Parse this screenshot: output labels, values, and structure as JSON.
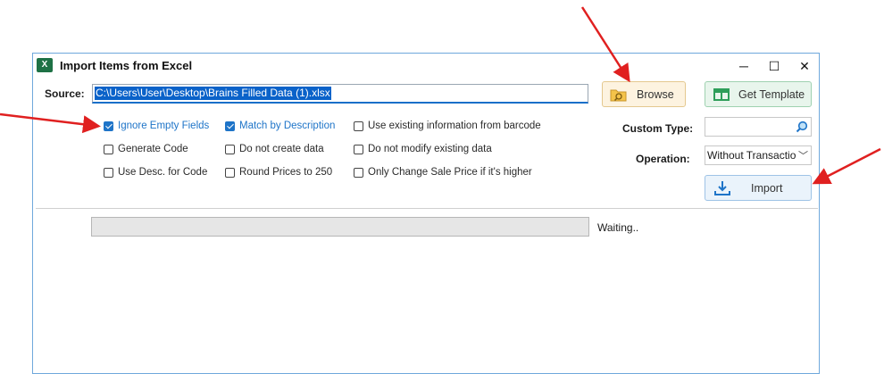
{
  "window": {
    "title": "Import Items from Excel",
    "controls": [
      "─",
      "☐",
      "✕"
    ]
  },
  "source": {
    "label": "Source:",
    "value": "C:\\Users\\User\\Desktop\\Brains Filled Data (1).xlsx"
  },
  "buttons": {
    "browse": "Browse",
    "get_template": "Get Template",
    "import": "Import"
  },
  "options": [
    {
      "label": "Ignore Empty Fields",
      "checked": true
    },
    {
      "label": "Match by Description",
      "checked": true
    },
    {
      "label": "Use existing information from barcode",
      "checked": false
    },
    {
      "label": "Generate Code",
      "checked": false
    },
    {
      "label": "Do not create data",
      "checked": false
    },
    {
      "label": "Do not modify existing data",
      "checked": false
    },
    {
      "label": "Use Desc. for Code",
      "checked": false
    },
    {
      "label": "Round Prices to 250",
      "checked": false
    },
    {
      "label": "Only Change Sale Price if it's higher",
      "checked": false
    }
  ],
  "custom_type": {
    "label": "Custom Type:",
    "value": ""
  },
  "operation": {
    "label": "Operation:",
    "value": "Without Transactions"
  },
  "progress": {
    "value": 0,
    "status": "Waiting.."
  },
  "colors": {
    "accent": "#1e74c8",
    "annotation_arrow": "#e02020",
    "excel_green": "#1e7145"
  },
  "icons": [
    "excel-icon",
    "folder-search-icon",
    "grid-template-icon",
    "search-icon",
    "download-icon",
    "chevron-down-icon"
  ]
}
